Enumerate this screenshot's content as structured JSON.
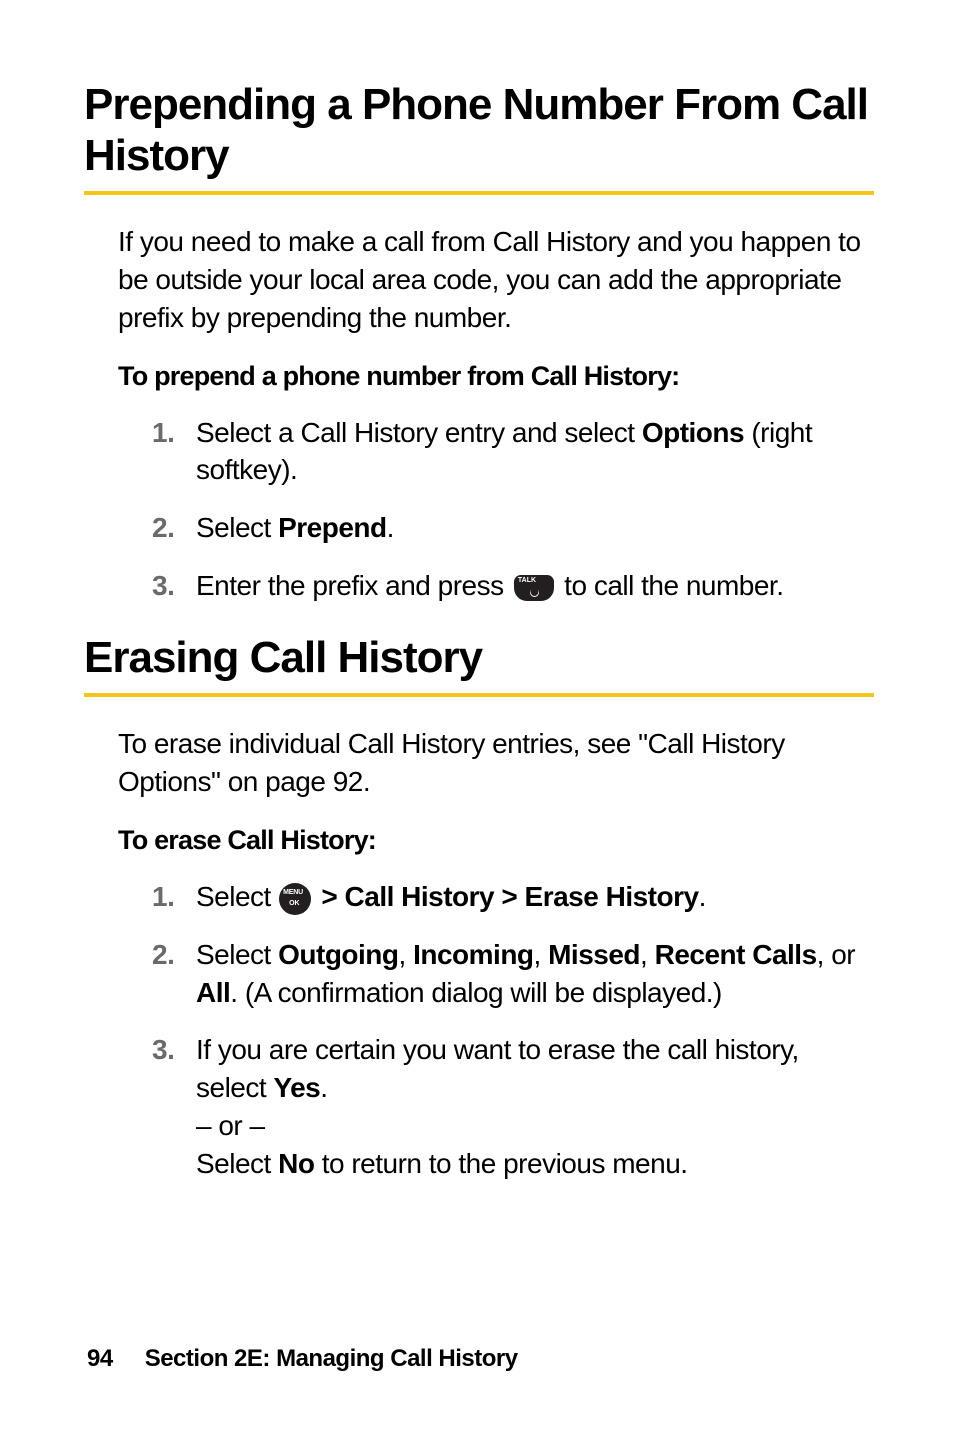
{
  "heading1": "Prepending a Phone Number From Call History",
  "section1": {
    "intro": "If you need to make a call from Call History and you happen to be outside your local area code, you can add the appropriate prefix by prepending the number.",
    "subhead": "To prepend a phone number from Call History:",
    "steps": [
      {
        "num": "1.",
        "before": "Select a Call History entry and select ",
        "bold": "Options",
        "after": " (right softkey)."
      },
      {
        "num": "2.",
        "before": "Select ",
        "bold": "Prepend",
        "after": "."
      },
      {
        "num": "3.",
        "before": "Enter the prefix and press ",
        "after_icon": " to call the number."
      }
    ]
  },
  "heading2": "Erasing Call History",
  "section2": {
    "intro": "To erase individual Call History entries, see \"Call History Options\" on page 92.",
    "subhead": "To erase Call History:",
    "steps": [
      {
        "num": "1.",
        "before": "Select ",
        "bold_after_icon": " > Call History > Erase History",
        "after": "."
      },
      {
        "num": "2.",
        "before": "Select ",
        "b1": "Outgoing",
        "s1": ", ",
        "b2": "Incoming",
        "s2": ", ",
        "b3": "Missed",
        "s3": ", ",
        "b4": "Recent Calls",
        "s4": ", or ",
        "b5": "All",
        "after": ". (A confirmation dialog will be displayed.)"
      },
      {
        "num": "3.",
        "line1_before": "If you are certain you want to erase the call history, select ",
        "line1_bold": "Yes",
        "line1_after": ".",
        "or": "– or –",
        "line2_before": "Select ",
        "line2_bold": "No",
        "line2_after": " to return to the previous menu."
      }
    ]
  },
  "footer": {
    "page": "94",
    "section": "Section 2E: Managing Call History"
  }
}
